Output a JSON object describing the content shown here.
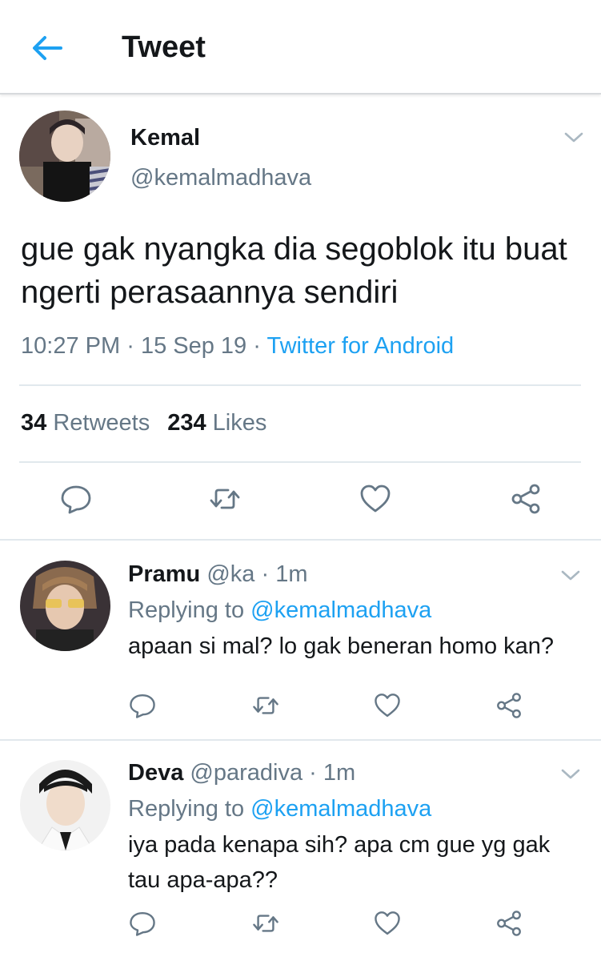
{
  "header": {
    "title": "Tweet"
  },
  "tweet": {
    "name": "Kemal",
    "handle": "@kemalmadhava",
    "text": "gue gak nyangka dia segoblok itu buat ngerti perasaannya sendiri",
    "time": "10:27 PM",
    "dot1": "·",
    "date": "15 Sep 19",
    "dot2": "·",
    "source": "Twitter for Android",
    "retweets_count": "34",
    "retweets_label": "Retweets",
    "likes_count": "234",
    "likes_label": "Likes"
  },
  "replies": [
    {
      "name": "Pramu",
      "handle": "@ka",
      "dot": "·",
      "time": "1m",
      "replying_label": "Replying to",
      "replying_to": "@kemalmadhava",
      "text": "apaan si mal? lo gak beneran homo kan?"
    },
    {
      "name": "Deva",
      "handle": "@paradiva",
      "dot": "·",
      "time": "1m",
      "replying_label": "Replying to",
      "replying_to": "@kemalmadhava",
      "text": "iya pada kenapa sih? apa cm gue yg gak tau apa-apa??"
    }
  ],
  "colors": {
    "accent": "#1da1f2",
    "muted": "#657786",
    "text": "#14171a",
    "divider": "#e1e8ed"
  },
  "icons": [
    "back-arrow-icon",
    "chevron-down-icon",
    "reply-icon",
    "retweet-icon",
    "like-icon",
    "share-icon"
  ]
}
